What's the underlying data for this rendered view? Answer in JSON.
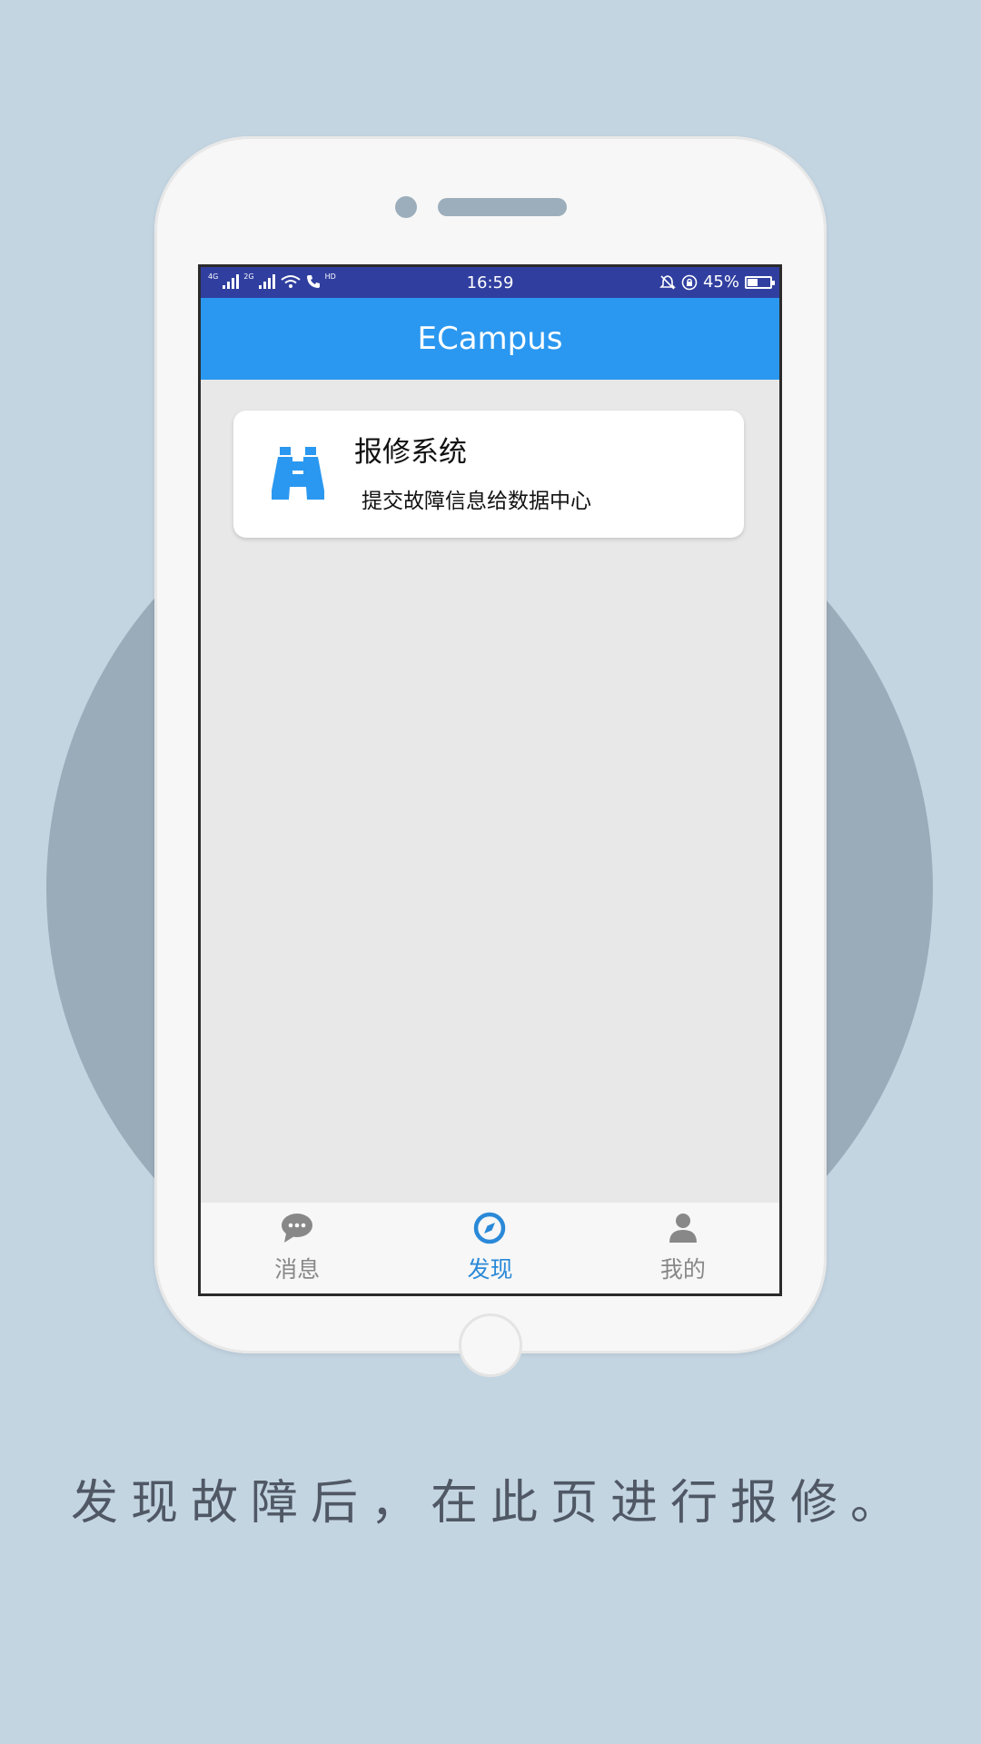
{
  "status_bar": {
    "network_left": "4G",
    "network_right": "2G",
    "call_badge": "HD",
    "time": "16:59",
    "battery_percent": "45%",
    "battery_level": 0.45,
    "icons": [
      "signal-icon",
      "wifi-icon",
      "call-icon",
      "mute-icon",
      "rotation-lock-icon",
      "battery-icon"
    ]
  },
  "app_bar": {
    "title": "ECampus"
  },
  "cards": [
    {
      "icon": "binoculars-icon",
      "title": "报修系统",
      "description": "提交故障信息给数据中心"
    }
  ],
  "bottom_nav": {
    "active_index": 1,
    "items": [
      {
        "label": "消息",
        "icon": "chat-icon"
      },
      {
        "label": "发现",
        "icon": "compass-icon"
      },
      {
        "label": "我的",
        "icon": "person-icon"
      }
    ]
  },
  "caption": "发现故障后，在此页进行报修。",
  "colors": {
    "background": "#c4d5e2",
    "circle": "#9aabb9",
    "status_bar": "#303f9f",
    "app_bar": "#2a98f0",
    "accent": "#2a89d8",
    "nav_inactive": "#888888"
  }
}
